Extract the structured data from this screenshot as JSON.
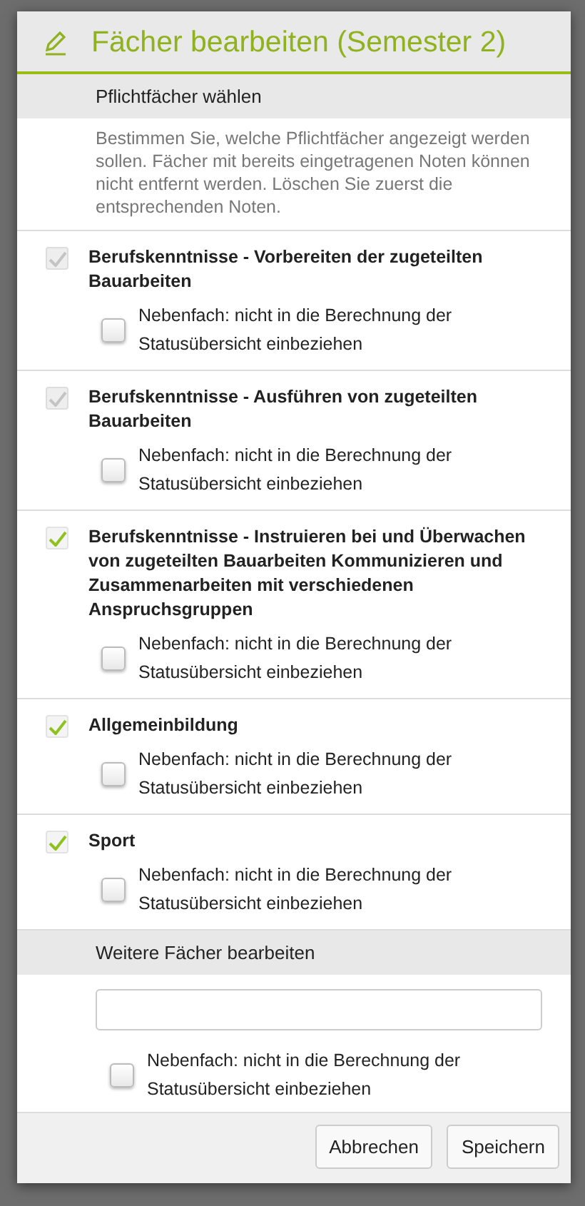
{
  "dialog": {
    "title": "Fächer bearbeiten (Semester 2)"
  },
  "required_section": {
    "heading": "Pflichtfächer wählen",
    "description": "Bestimmen Sie, welche Pflichtfächer angezeigt werden sollen. Fächer mit bereits eingetragenen Noten können nicht entfernt werden. Löschen Sie zuerst die entsprechenden Noten.",
    "subjects": [
      {
        "label": "Berufskenntnisse - Vorbereiten der zugeteilten Bauarbeiten",
        "checked": true,
        "disabled": true,
        "minor_label": "Nebenfach: nicht in die Berechnung der Statusübersicht einbeziehen",
        "minor_checked": false
      },
      {
        "label": "Berufskenntnisse - Ausführen von zugeteilten Bauarbeiten",
        "checked": true,
        "disabled": true,
        "minor_label": "Nebenfach: nicht in die Berechnung der Statusübersicht einbeziehen",
        "minor_checked": false
      },
      {
        "label": "Berufskenntnisse - Instruieren bei und Überwachen von zugeteilten Bauarbeiten Kommunizieren und Zusammenarbeiten mit verschiedenen Anspruchsgruppen",
        "checked": true,
        "disabled": false,
        "minor_label": "Nebenfach: nicht in die Berechnung der Statusübersicht einbeziehen",
        "minor_checked": false
      },
      {
        "label": "Allgemeinbildung",
        "checked": true,
        "disabled": false,
        "minor_label": "Nebenfach: nicht in die Berechnung der Statusübersicht einbeziehen",
        "minor_checked": false
      },
      {
        "label": "Sport",
        "checked": true,
        "disabled": false,
        "minor_label": "Nebenfach: nicht in die Berechnung der Statusübersicht einbeziehen",
        "minor_checked": false
      }
    ]
  },
  "other_section": {
    "heading": "Weitere Fächer bearbeiten",
    "minor_label": "Nebenfach: nicht in die Berechnung der Statusübersicht einbeziehen",
    "minor_checked": false
  },
  "buttons": [
    "Abbrechen",
    "Speichern"
  ]
}
